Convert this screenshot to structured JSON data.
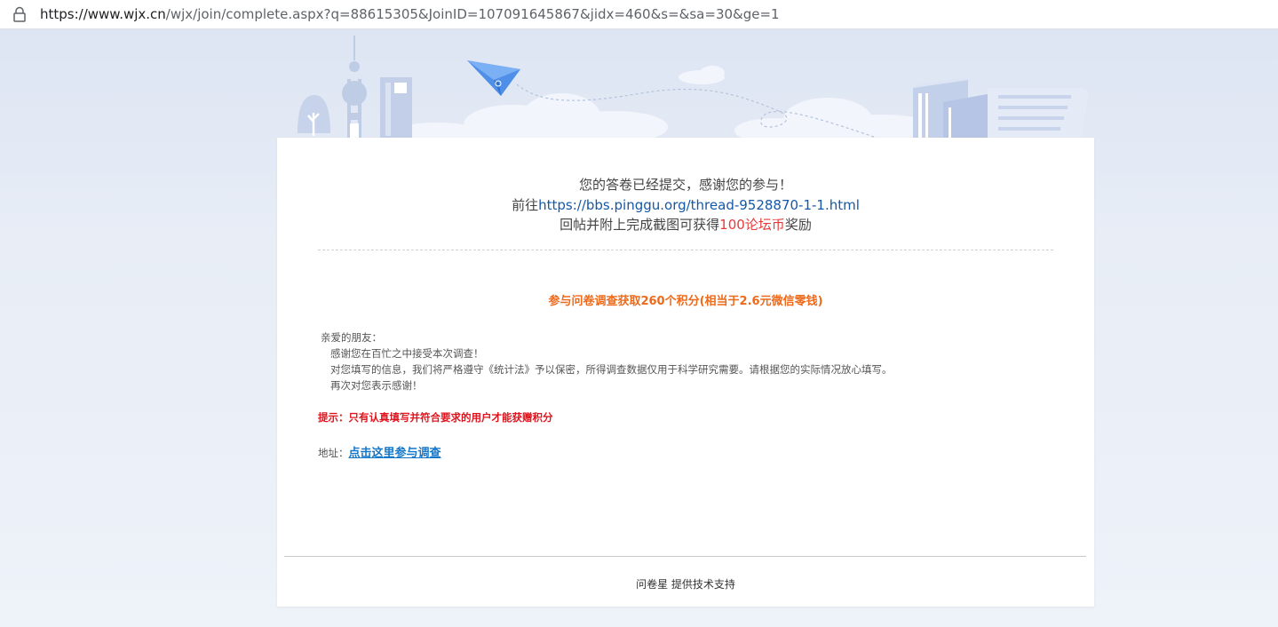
{
  "browser": {
    "url_host": "https://www.wjx.cn",
    "url_path": "/wjx/join/complete.aspx?q=88615305&JoinID=107091645867&jidx=460&s=&sa=30&ge=1"
  },
  "colors": {
    "link": "#1558a6",
    "coins": "#e63b3b",
    "earn": "#ee6a1b",
    "tip": "#e0141e",
    "survey_link": "#1476c8"
  },
  "message": {
    "line1": "您的答卷已经提交，感谢您的参与！",
    "line2_prefix": "前往",
    "line2_link": "https://bbs.pinggu.org/thread-9528870-1-1.html",
    "line3_prefix": "回帖并附上完成截图可获得",
    "line3_highlight": "100论坛币",
    "line3_suffix": "奖励"
  },
  "reward": {
    "text": "参与问卷调查获取260个积分(相当于2.6元微信零钱)"
  },
  "letter": {
    "greeting": "亲爱的朋友：",
    "lines": [
      "感谢您在百忙之中接受本次调查！",
      "对您填写的信息，我们将严格遵守《统计法》予以保密，所得调查数据仅用于科学研究需要。请根据您的实际情况放心填写。",
      "再次对您表示感谢！"
    ]
  },
  "tip": {
    "text": "提示：只有认真填写并符合要求的用户才能获赠积分"
  },
  "address": {
    "label": "地址：",
    "link_text": "点击这里参与调查"
  },
  "footer": {
    "text": "问卷星 提供技术支持"
  }
}
